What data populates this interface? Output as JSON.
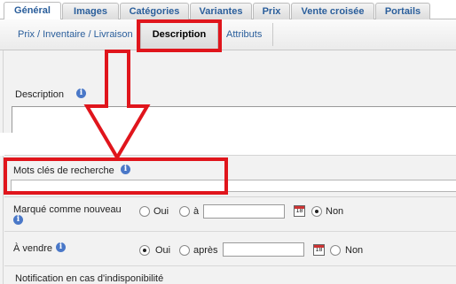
{
  "tabs": [
    {
      "label": "Général",
      "active": true
    },
    {
      "label": "Images",
      "active": false
    },
    {
      "label": "Catégories",
      "active": false
    },
    {
      "label": "Variantes",
      "active": false
    },
    {
      "label": "Prix",
      "active": false
    },
    {
      "label": "Vente croisée",
      "active": false
    },
    {
      "label": "Portails",
      "active": false
    }
  ],
  "subtabs": [
    {
      "label": "Prix / Inventaire / Livraison",
      "active": false
    },
    {
      "label": "Description",
      "active": true
    },
    {
      "label": "Attributs",
      "active": false
    }
  ],
  "form": {
    "description_label": "Description",
    "description_value": "",
    "keywords_label": "Mots clés de recherche",
    "keywords_value": "",
    "new_label": "Marqué comme nouveau",
    "new_options": {
      "yes": "Oui",
      "on": "à",
      "no": "Non"
    },
    "new_selected": "no",
    "new_date": "",
    "sale_label": "À vendre",
    "sale_options": {
      "yes": "Oui",
      "after": "après",
      "no": "Non"
    },
    "sale_selected": "yes",
    "sale_date": "",
    "unavailable_label": "Notification en cas d'indisponibilité"
  },
  "icons": {
    "info": "info-icon",
    "calendar": "calendar-icon",
    "calendar_day": "18"
  },
  "colors": {
    "tab_text": "#2a5e9b",
    "annotation": "#e0151c",
    "info_icon": "#4a78c8"
  }
}
